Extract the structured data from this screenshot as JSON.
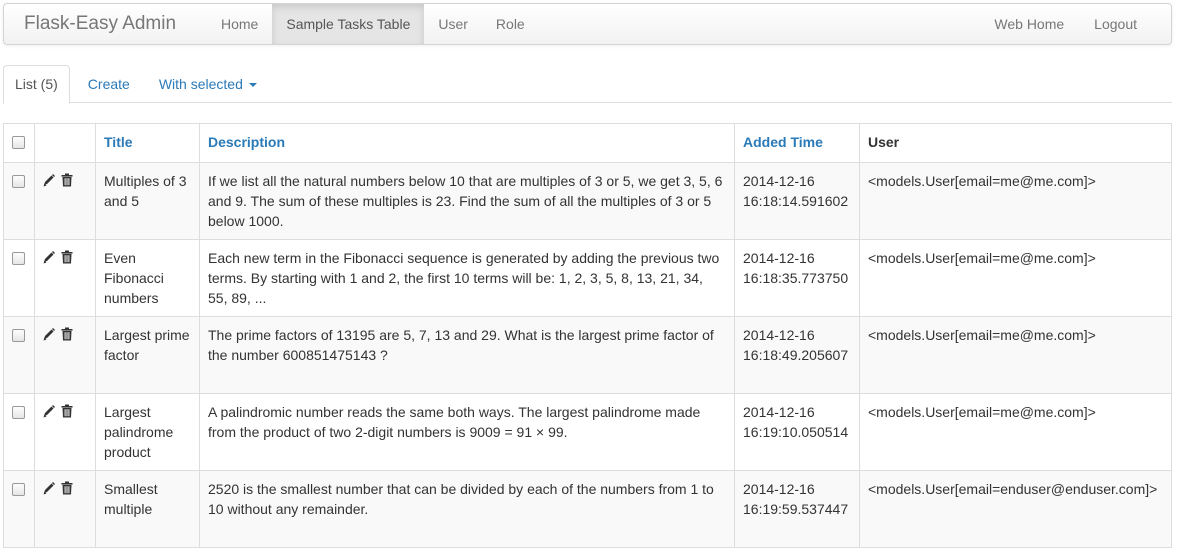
{
  "navbar": {
    "brand": "Flask-Easy Admin",
    "left_items": [
      "Home",
      "Sample Tasks Table",
      "User",
      "Role"
    ],
    "active_index": 1,
    "right_items": [
      "Web Home",
      "Logout"
    ]
  },
  "tabs": {
    "list": "List (5)",
    "create": "Create",
    "with_selected": "With selected"
  },
  "table": {
    "headers": {
      "title": "Title",
      "description": "Description",
      "added_time": "Added Time",
      "user": "User"
    },
    "rows": [
      {
        "title": "Multiples of 3 and 5",
        "description": "If we list all the natural numbers below 10 that are multiples of 3 or 5, we get 3, 5, 6 and 9. The sum of these multiples is 23. Find the sum of all the multiples of 3 or 5 below 1000.",
        "date": "2014-12-16",
        "time": "16:18:14.591602",
        "user": "<models.User[email=me@me.com]>"
      },
      {
        "title": "Even Fibonacci numbers",
        "description": "Each new term in the Fibonacci sequence is generated by adding the previous two terms. By starting with 1 and 2, the first 10 terms will be: 1, 2, 3, 5, 8, 13, 21, 34, 55, 89, ...",
        "date": "2014-12-16",
        "time": "16:18:35.773750",
        "user": "<models.User[email=me@me.com]>"
      },
      {
        "title": "Largest prime factor",
        "description": "The prime factors of 13195 are 5, 7, 13 and 29. What is the largest prime factor of the number 600851475143 ?",
        "date": "2014-12-16",
        "time": "16:18:49.205607",
        "user": "<models.User[email=me@me.com]>"
      },
      {
        "title": "Largest palindrome product",
        "description": "A palindromic number reads the same both ways. The largest palindrome made from the product of two 2-digit numbers is 9009 = 91 × 99.",
        "date": "2014-12-16",
        "time": "16:19:10.050514",
        "user": "<models.User[email=me@me.com]>"
      },
      {
        "title": "Smallest multiple",
        "description": "2520 is the smallest number that can be divided by each of the numbers from 1 to 10 without any remainder.",
        "date": "2014-12-16",
        "time": "16:19:59.537447",
        "user": "<models.User[email=enduser@enduser.com]>"
      }
    ]
  },
  "colors": {
    "link": "#2a7ab8",
    "nav_text": "#777777",
    "border": "#dddddd",
    "stripe": "#f9f9f9"
  }
}
